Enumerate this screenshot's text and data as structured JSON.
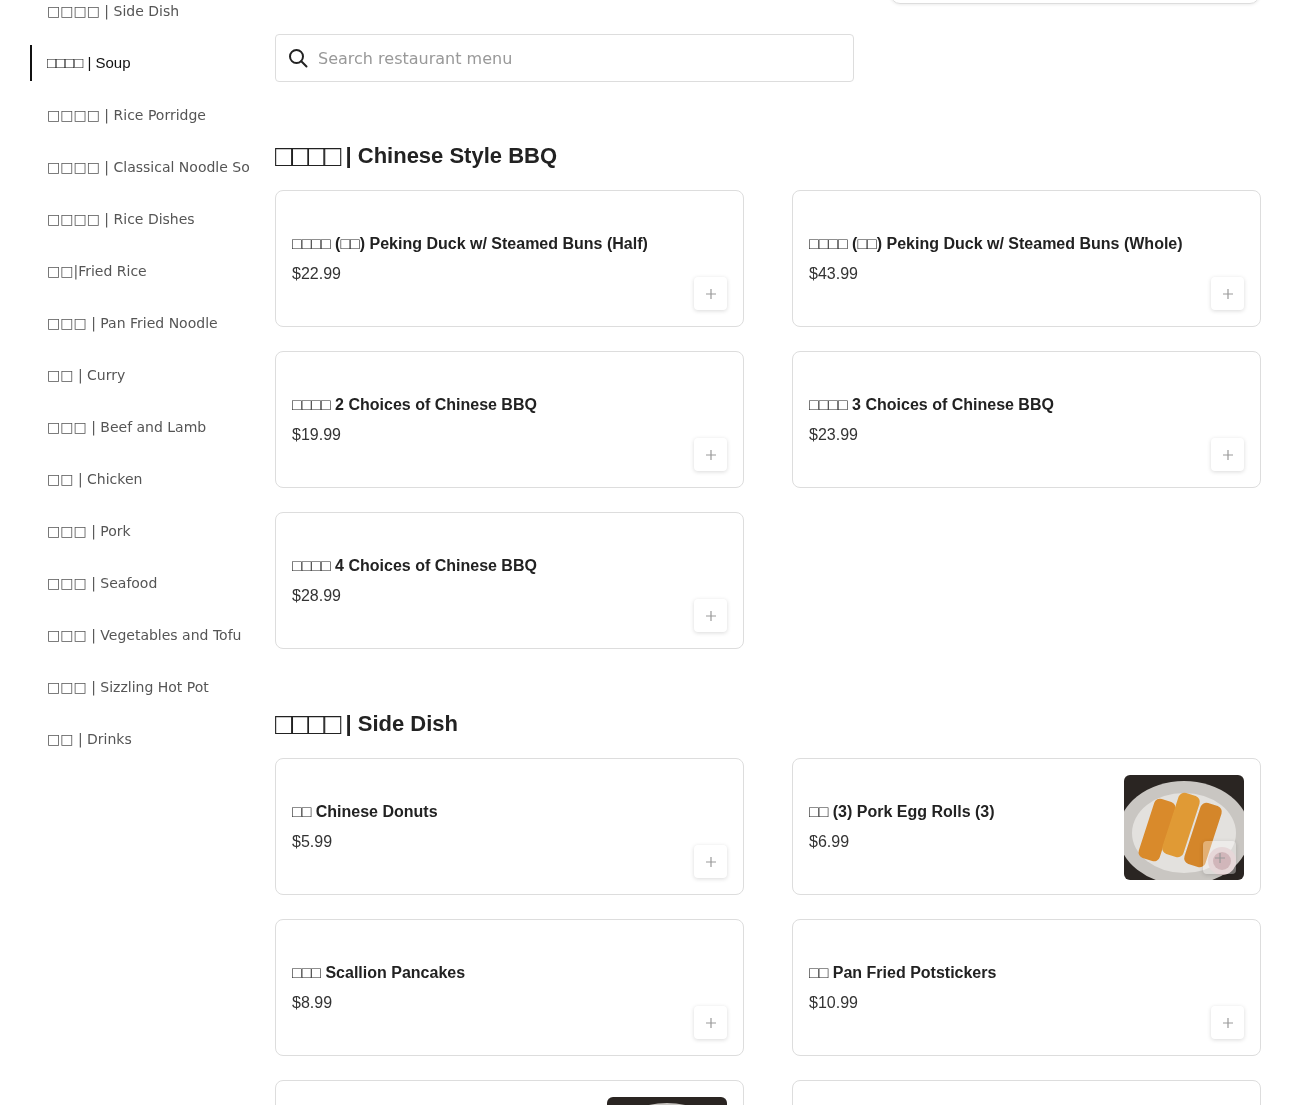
{
  "sidebar": {
    "items": [
      {
        "label": "□□□□ | Side Dish",
        "selected": false
      },
      {
        "label": "□□□□ | Soup",
        "selected": true
      },
      {
        "label": "□□□□ | Rice Porridge",
        "selected": false
      },
      {
        "label": "□□□□ | Classical Noodle So",
        "selected": false
      },
      {
        "label": "□□□□ | Rice Dishes",
        "selected": false
      },
      {
        "label": "□□|Fried Rice",
        "selected": false
      },
      {
        "label": "□□□ | Pan Fried Noodle",
        "selected": false
      },
      {
        "label": "□□ | Curry",
        "selected": false
      },
      {
        "label": "□□□ | Beef and Lamb",
        "selected": false
      },
      {
        "label": "□□ | Chicken",
        "selected": false
      },
      {
        "label": "□□□ | Pork",
        "selected": false
      },
      {
        "label": "□□□ | Seafood",
        "selected": false
      },
      {
        "label": "□□□ | Vegetables and Tofu",
        "selected": false
      },
      {
        "label": "□□□ | Sizzling Hot Pot",
        "selected": false
      },
      {
        "label": "□□ | Drinks",
        "selected": false
      }
    ]
  },
  "search": {
    "placeholder": "Search restaurant menu"
  },
  "sections": [
    {
      "title_cjk": "□□□□",
      "title": "| Chinese Style BBQ",
      "items": [
        {
          "name": "□□□□ (□□) Peking Duck w/ Steamed Buns (Half)",
          "price": "$22.99",
          "picture": false
        },
        {
          "name": "□□□□ (□□) Peking Duck w/ Steamed Buns (Whole)",
          "price": "$43.99",
          "picture": false
        },
        {
          "name": "□□□□ 2 Choices of Chinese BBQ",
          "price": "$19.99",
          "picture": false
        },
        {
          "name": "□□□□ 3 Choices of Chinese BBQ",
          "price": "$23.99",
          "picture": false
        },
        {
          "name": "□□□□ 4 Choices of Chinese BBQ",
          "price": "$28.99",
          "picture": false
        }
      ]
    },
    {
      "title_cjk": "□□□□",
      "title": "| Side Dish",
      "items": [
        {
          "name": "□□ Chinese Donuts",
          "price": "$5.99",
          "picture": false
        },
        {
          "name": "□□ (3) Pork Egg Rolls (3)",
          "price": "$6.99",
          "picture": true
        },
        {
          "name": "□□□ Scallion Pancakes",
          "price": "$8.99",
          "picture": false
        },
        {
          "name": "□□ Pan Fried Potstickers",
          "price": "$10.99",
          "picture": false
        },
        {
          "picture": true
        },
        {
          "picture": false
        }
      ]
    }
  ]
}
